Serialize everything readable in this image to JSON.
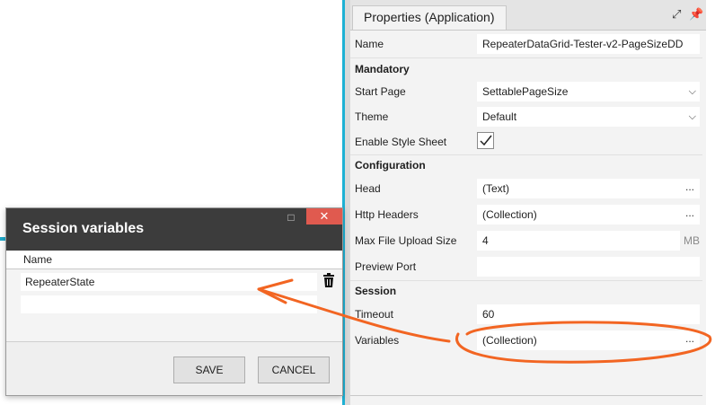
{
  "properties": {
    "tab_title": "Properties (Application)",
    "expand_icon": "expand-icon",
    "pin_icon": "pin-icon",
    "name_label": "Name",
    "name_value": "RepeaterDataGrid-Tester-v2-PageSizeDD",
    "section_mandatory": "Mandatory",
    "start_page_label": "Start Page",
    "start_page_value": "SettablePageSize",
    "theme_label": "Theme",
    "theme_value": "Default",
    "enable_style_label": "Enable Style Sheet",
    "enable_style_checked": true,
    "section_configuration": "Configuration",
    "head_label": "Head",
    "head_value": "(Text)",
    "http_headers_label": "Http Headers",
    "http_headers_value": "(Collection)",
    "max_upload_label": "Max File Upload Size",
    "max_upload_value": "4",
    "max_upload_unit": "MB",
    "preview_port_label": "Preview Port",
    "preview_port_value": "",
    "section_session": "Session",
    "timeout_label": "Timeout",
    "timeout_value": "60",
    "variables_label": "Variables",
    "variables_value": "(Collection)",
    "ellipsis": "..."
  },
  "dialog": {
    "title": "Session variables",
    "column_name": "Name",
    "rows": [
      "RepeaterState",
      ""
    ],
    "save_label": "SAVE",
    "cancel_label": "CANCEL"
  },
  "colors": {
    "accent": "#1eb1d4",
    "annotation": "#f26522",
    "dialog_title_bg": "#3c3c3c",
    "close_button": "#e05a4f"
  }
}
